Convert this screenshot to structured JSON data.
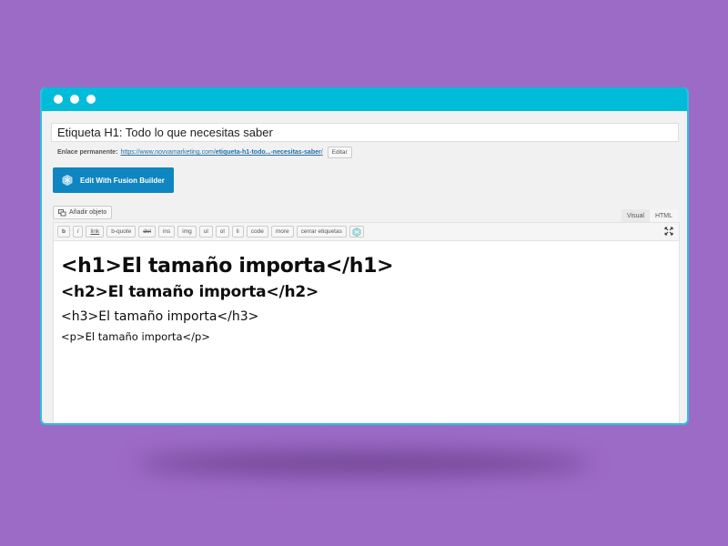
{
  "window": {
    "titlebar_color": "#00bcd9",
    "background_color": "#9c6bc6"
  },
  "post": {
    "title": "Etiqueta H1: Todo lo que necesitas saber",
    "permalink_label": "Enlace permanente:",
    "permalink_url_prefix": "https://www.novvamarketing.com/",
    "permalink_slug": "etiqueta-h1-todo...-necesitas-saber",
    "permalink_suffix": "/",
    "edit_permalink_label": "Editar"
  },
  "builder": {
    "button_label": "Edit With Fusion Builder",
    "button_color": "#0f85c1"
  },
  "media": {
    "add_media_label": "Añadir objeto"
  },
  "editor_tabs": [
    {
      "label": "Visual"
    },
    {
      "label": "HTML"
    }
  ],
  "quicktags": [
    {
      "label": "b"
    },
    {
      "label": "i"
    },
    {
      "label": "link"
    },
    {
      "label": "b-quote"
    },
    {
      "label": "del"
    },
    {
      "label": "ins"
    },
    {
      "label": "img"
    },
    {
      "label": "ul"
    },
    {
      "label": "ol"
    },
    {
      "label": "li"
    },
    {
      "label": "code"
    },
    {
      "label": "more"
    },
    {
      "label": "cerrar etiquetas"
    }
  ],
  "content": {
    "h1": "<h1>El tamaño importa</h1>",
    "h2": "<h2>El tamaño importa</h2>",
    "h3": "<h3>El tamaño importa</h3>",
    "p": "<p>El tamaño importa</p>"
  }
}
